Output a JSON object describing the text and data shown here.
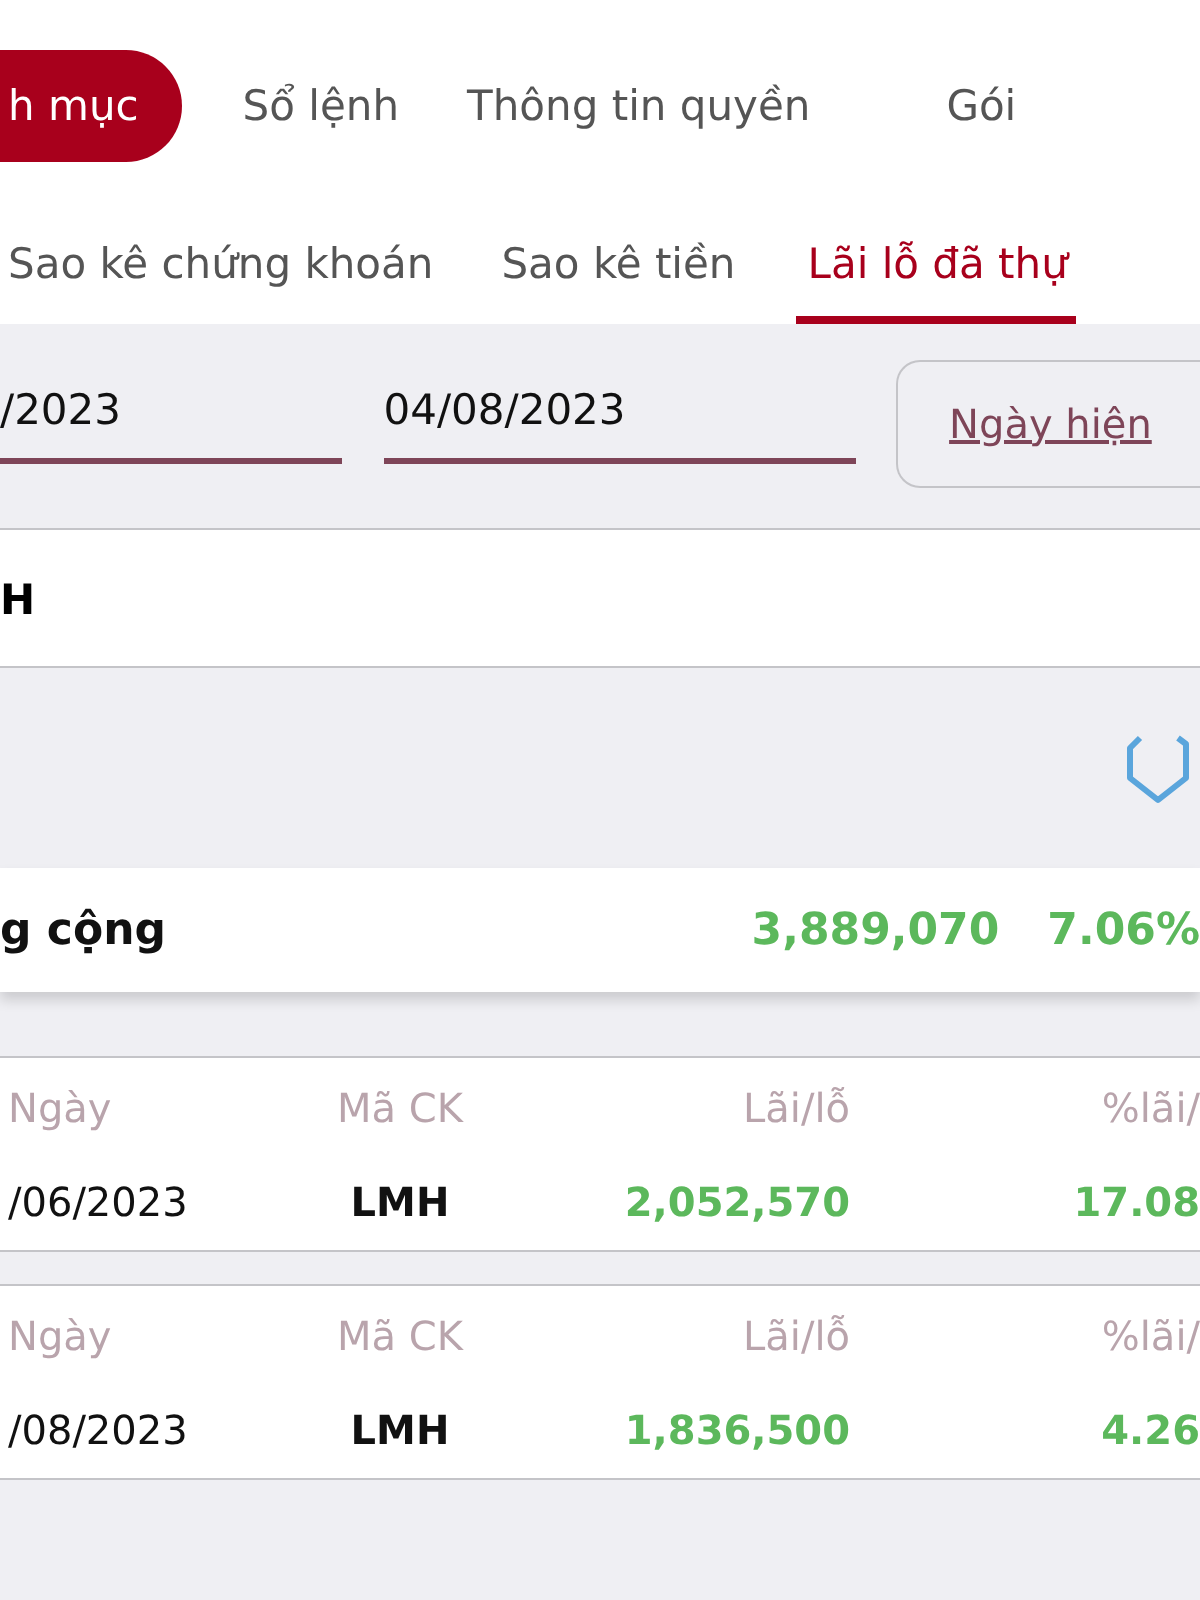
{
  "main_tabs": [
    {
      "label": "h mục",
      "selected": true
    },
    {
      "label": "Sổ lệnh",
      "selected": false
    },
    {
      "label": "Thông tin quyền",
      "selected": false
    },
    {
      "label": "Gói",
      "selected": false
    }
  ],
  "sub_tabs": [
    {
      "label": "Sao kê chứng khoán",
      "selected": false
    },
    {
      "label": "Sao kê tiền",
      "selected": false
    },
    {
      "label": "Lãi lỗ đã thự",
      "selected": true
    }
  ],
  "date_from": {
    "value": "/2023"
  },
  "date_to": {
    "value": "04/08/2023"
  },
  "today_button": "Ngày hiện",
  "symbol_field": {
    "value": "H"
  },
  "summary": {
    "label": "g cộng",
    "profit": "3,889,070",
    "percent": "7.06%"
  },
  "records": [
    {
      "date_label": "Ngày",
      "symbol_label": "Mã CK",
      "profit_label": "Lãi/lỗ",
      "percent_label": "%lãi/",
      "date": "/06/2023",
      "symbol": "LMH",
      "profit": "2,052,570",
      "percent": "17.08"
    },
    {
      "date_label": "Ngày",
      "symbol_label": "Mã CK",
      "profit_label": "Lãi/lỗ",
      "percent_label": "%lãi/",
      "date": "/08/2023",
      "symbol": "LMH",
      "profit": "1,836,500",
      "percent": "4.26"
    }
  ]
}
